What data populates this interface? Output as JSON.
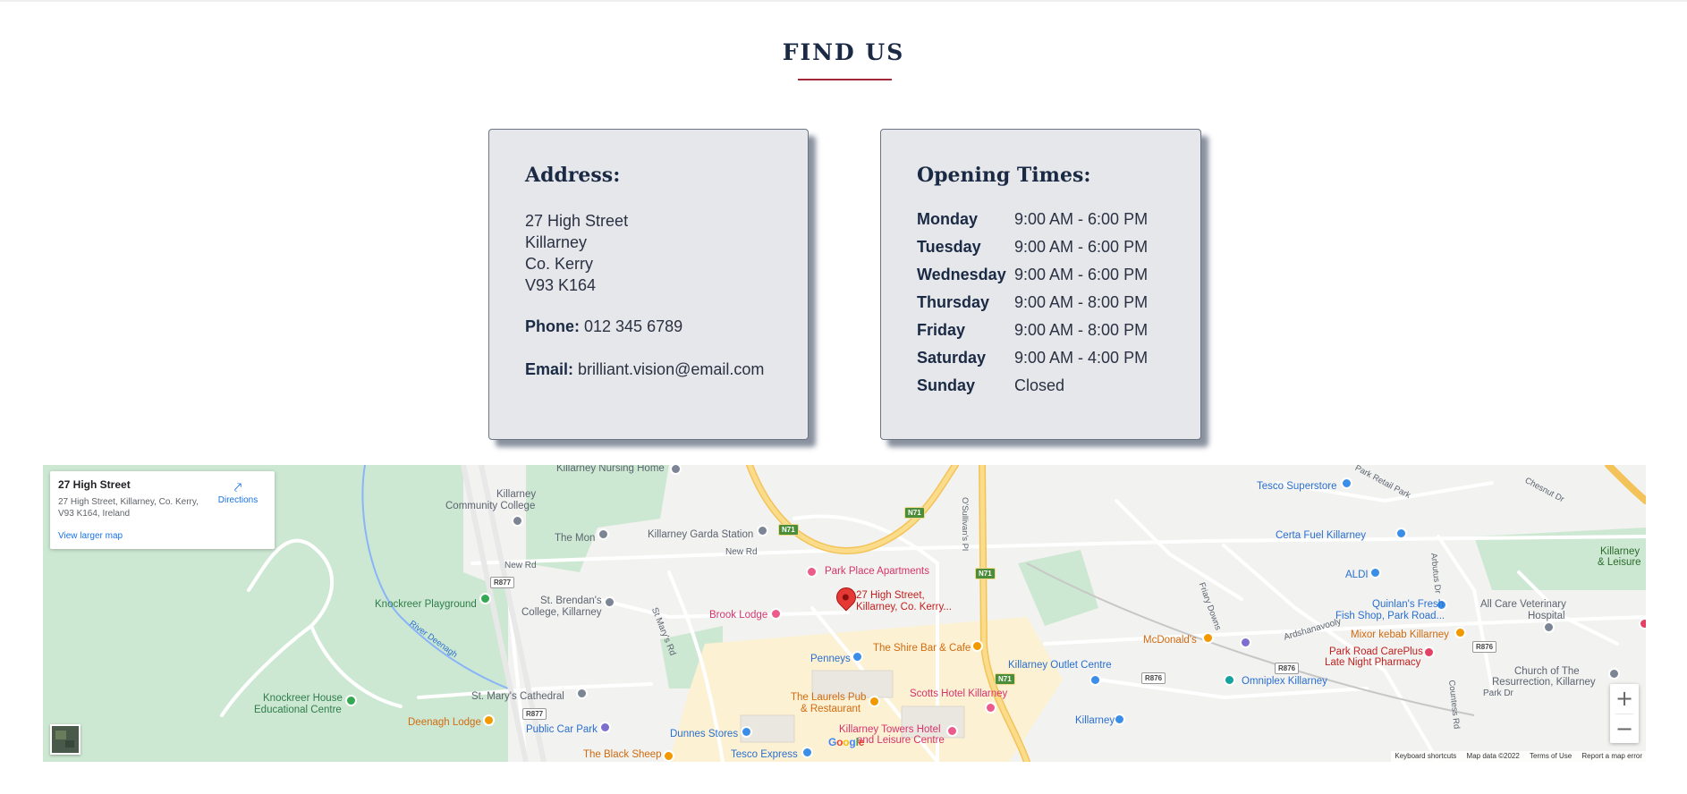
{
  "section": {
    "title": "FIND US"
  },
  "address": {
    "title": "Address:",
    "lines": [
      "27 High Street",
      "Killarney",
      "Co. Kerry",
      "V93 K164"
    ],
    "phone_label": "Phone:",
    "phone": "012 345 6789",
    "email_label": "Email:",
    "email": "brilliant.vision@email.com"
  },
  "hours": {
    "title": "Opening Times:",
    "rows": [
      {
        "day": "Monday",
        "time": "9:00 AM - 6:00 PM"
      },
      {
        "day": "Tuesday",
        "time": "9:00 AM - 6:00 PM"
      },
      {
        "day": "Wednesday",
        "time": "9:00 AM - 6:00 PM"
      },
      {
        "day": "Thursday",
        "time": "9:00 AM - 8:00 PM"
      },
      {
        "day": "Friday",
        "time": "9:00 AM - 8:00 PM"
      },
      {
        "day": "Saturday",
        "time": "9:00 AM - 4:00 PM"
      },
      {
        "day": "Sunday",
        "time": "Closed"
      }
    ]
  },
  "map": {
    "info": {
      "title": "27 High Street",
      "address": "27 High Street, Killarney, Co. Kerry, V93 K164, Ireland",
      "larger_map": "View larger map",
      "directions": "Directions"
    },
    "marker_label_line1": "27 High Street,",
    "marker_label_line2": "Killarney, Co. Kerry...",
    "labels": {
      "nursing_home": "Killarney Nursing Home",
      "community_college_1": "Killarney",
      "community_college_2": "Community College",
      "the_mon": "The Mon",
      "garda": "Killarney Garda Station",
      "new_rd_1": "New Rd",
      "new_rd_2": "New Rd",
      "park_place": "Park Place Apartments",
      "brendans_1": "St. Brendan's",
      "brendans_2": "College, Killarney",
      "st_marys_rd": "St Mary's Rd",
      "brook_lodge": "Brook Lodge",
      "knockreer": "Knockreer Playground",
      "river": "River Deenagh",
      "pennys": "Penneys",
      "shire_bar": "The Shire Bar & Cafe",
      "outlet": "Killarney Outlet Centre",
      "cathedral": "St. Mary's Cathedral",
      "laurels_1": "The Laurels Pub",
      "laurels_2": "& Restaurant",
      "scotts": "Scotts Hotel Killarney",
      "knockreer_house_1": "Knockreer House",
      "knockreer_house_2": "Educational Centre",
      "deenagh_lodge": "Deenagh Lodge",
      "public_car_park": "Public Car Park",
      "dunnes": "Dunnes Stores",
      "towers_1": "Killarney Towers Hotel",
      "towers_2": "and Leisure Centre",
      "black_sheep": "The Black Sheep",
      "tesco_express": "Tesco Express",
      "killarney_station": "Killarney",
      "tesco_superstore": "Tesco Superstore",
      "retail_park": "Park Retail Park",
      "chesnut": "Chesnut Dr",
      "certa": "Certa Fuel Killarney",
      "aldi": "ALDI",
      "quinlans_1": "Quinlan's Fresh",
      "quinlans_2": "Fish Shop, Park Road...",
      "vet_1": "All Care Veterinary",
      "vet_2": "Hospital",
      "mcdonalds": "McDonald's",
      "ardshanavooly": "Ardshanavooly",
      "mixor": "Mixor kebab Killarney",
      "pharmacy_1": "Park Road CarePlus",
      "pharmacy_2": "Late Night Pharmacy",
      "omniplex": "Omniplex Killarney",
      "church_1": "Church of The",
      "church_2": "Resurrection, Killarney",
      "park_dr": "Park Dr",
      "killarney_leisure_1": "Killarney",
      "killarney_leisure_2": "& Leisure",
      "friary": "Friary Downs",
      "arbutus": "Arbutus Dr",
      "countess": "Countess Rd",
      "osullivans": "O'Sullivan's Pl"
    },
    "road_badges": {
      "n71_a": "N71",
      "n71_b": "N71",
      "n71_c": "N71",
      "n71_d": "N71",
      "r877_a": "R877",
      "r877_b": "R877",
      "r876_a": "R876",
      "r876_b": "R876",
      "r876_c": "R876"
    },
    "zoom_in": "+",
    "zoom_out": "−",
    "attribution": {
      "keyboard": "Keyboard shortcuts",
      "data": "Map data ©2022",
      "terms": "Terms of Use",
      "report": "Report a map error"
    },
    "colors": {
      "park": "#cde8d2",
      "road_major": "#f9d57a",
      "road_minor": "#ffffff",
      "town": "#fdf1d4",
      "water": "#8ab4f8",
      "marker": "#e53935"
    }
  }
}
